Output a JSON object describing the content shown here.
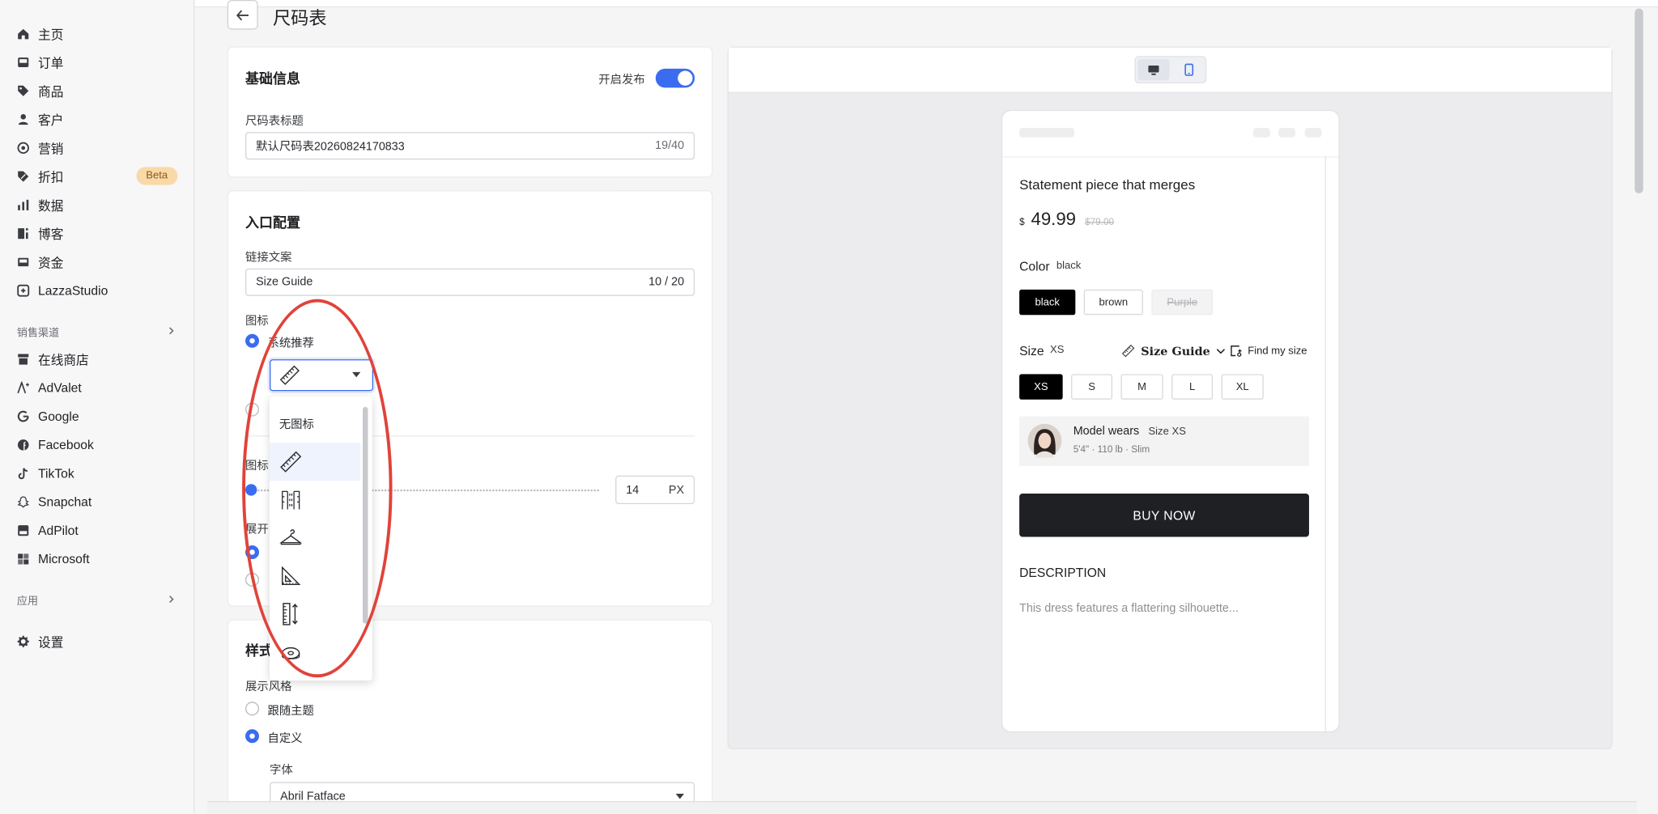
{
  "page_title": "尺码表",
  "sidebar": {
    "items": [
      {
        "label": "主页",
        "icon": "home-icon"
      },
      {
        "label": "订单",
        "icon": "inbox-icon"
      },
      {
        "label": "商品",
        "icon": "tag-icon"
      },
      {
        "label": "客户",
        "icon": "person-icon"
      },
      {
        "label": "营销",
        "icon": "target-icon"
      },
      {
        "label": "折扣",
        "icon": "discount-tag-icon",
        "badge": "Beta"
      },
      {
        "label": "数据",
        "icon": "bar-chart-icon"
      },
      {
        "label": "博客",
        "icon": "blog-icon"
      },
      {
        "label": "资金",
        "icon": "wallet-icon"
      },
      {
        "label": "LazzaStudio",
        "icon": "studio-icon"
      }
    ],
    "sales_channels_title": "销售渠道",
    "channels": [
      {
        "label": "在线商店",
        "icon": "store-icon"
      },
      {
        "label": "AdValet",
        "icon": "advalet-icon"
      },
      {
        "label": "Google",
        "icon": "google-icon"
      },
      {
        "label": "Facebook",
        "icon": "facebook-icon"
      },
      {
        "label": "TikTok",
        "icon": "tiktok-icon"
      },
      {
        "label": "Snapchat",
        "icon": "snapchat-icon"
      },
      {
        "label": "AdPilot",
        "icon": "adpilot-icon"
      },
      {
        "label": "Microsoft",
        "icon": "microsoft-icon"
      }
    ],
    "apps_title": "应用",
    "settings": {
      "label": "设置",
      "icon": "gear-icon"
    }
  },
  "basic_info": {
    "title": "基础信息",
    "publish_label": "开启发布",
    "publish_on": true,
    "size_chart_title_label": "尺码表标题",
    "size_chart_title_value": "默认尺码表20260824170833",
    "size_chart_title_count": "19/40"
  },
  "entry_config": {
    "title": "入口配置",
    "link_text_label": "链接文案",
    "link_text_value": "Size Guide",
    "link_text_count": "10 / 20",
    "icon_label": "图标",
    "icon_option_system": "系统推荐",
    "icon_size_label": "图标",
    "icon_size_value": "14",
    "icon_size_unit": "PX",
    "expand_label": "展开"
  },
  "icon_dropdown": {
    "selected_icon": "ruler-icon",
    "options": [
      {
        "label": "无图标"
      },
      {
        "icon": "ruler-icon"
      },
      {
        "icon": "measuring-tape-icon"
      },
      {
        "icon": "hanger-icon"
      },
      {
        "icon": "set-square-icon"
      },
      {
        "icon": "vertical-ruler-icon"
      },
      {
        "icon": "tape-measure-roll-icon"
      }
    ]
  },
  "style": {
    "title": "样式",
    "display_style_label": "展示风格",
    "option_follow_theme": "跟随主题",
    "option_custom": "自定义",
    "font_label": "字体",
    "font_value": "Abril Fatface"
  },
  "preview": {
    "product_title": "Statement piece that merges",
    "currency": "$",
    "price": "49.99",
    "compare_price": "$79.00",
    "color_label": "Color",
    "color_selected": "black",
    "colors": [
      "black",
      "brown",
      "Purple"
    ],
    "size_label": "Size",
    "size_selected": "XS",
    "size_guide_label": "Size Guide",
    "find_my_size": "Find my size",
    "sizes": [
      "XS",
      "S",
      "M",
      "L",
      "XL"
    ],
    "model_wears_label": "Model wears",
    "model_size": "Size XS",
    "model_details": "5'4\" · 110 lb · Slim",
    "buy_now": "BUY NOW",
    "description_title": "DESCRIPTION",
    "description_text": "This dress features a flattering silhouette..."
  }
}
